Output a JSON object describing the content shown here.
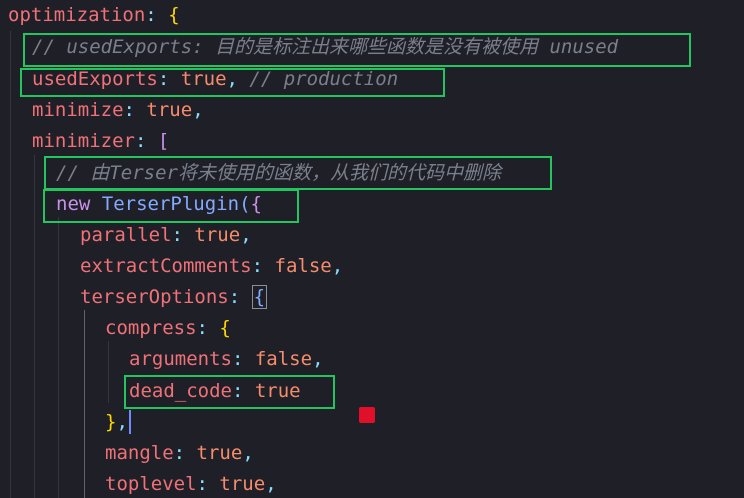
{
  "code": {
    "l1_key": "optimization",
    "colon": ":",
    "open_brace": "{",
    "open_bracket": "[",
    "close_brace": "}",
    "comma": ",",
    "open_paren": "(",
    "l2_comment": "// usedExports: 目的是标注出来哪些函数是没有被使用 unused",
    "l3_key": "usedExports",
    "l3_val": "true",
    "l3_comment": "// production",
    "l4_key": "minimize",
    "l4_val": "true",
    "l5_key": "minimizer",
    "l6_comment": "// 由Terser将未使用的函数，从我们的代码中删除",
    "l7_new": "new",
    "l7_class": "TerserPlugin",
    "l8_key": "parallel",
    "l8_val": "true",
    "l9_key": "extractComments",
    "l9_val": "false",
    "l10_key": "terserOptions",
    "l11_key": "compress",
    "l12_key": "arguments",
    "l12_val": "false",
    "l13_key": "dead_code",
    "l13_val": "true",
    "l15_key": "mangle",
    "l15_val": "true",
    "l16_key": "toplevel",
    "l16_val": "true"
  },
  "colors": {
    "background": "#1f2027",
    "highlight_box": "#22c55e",
    "marker": "#e0102a",
    "property": "#f07178",
    "boolean": "#f78c6c",
    "comment": "#7a7f8c"
  }
}
